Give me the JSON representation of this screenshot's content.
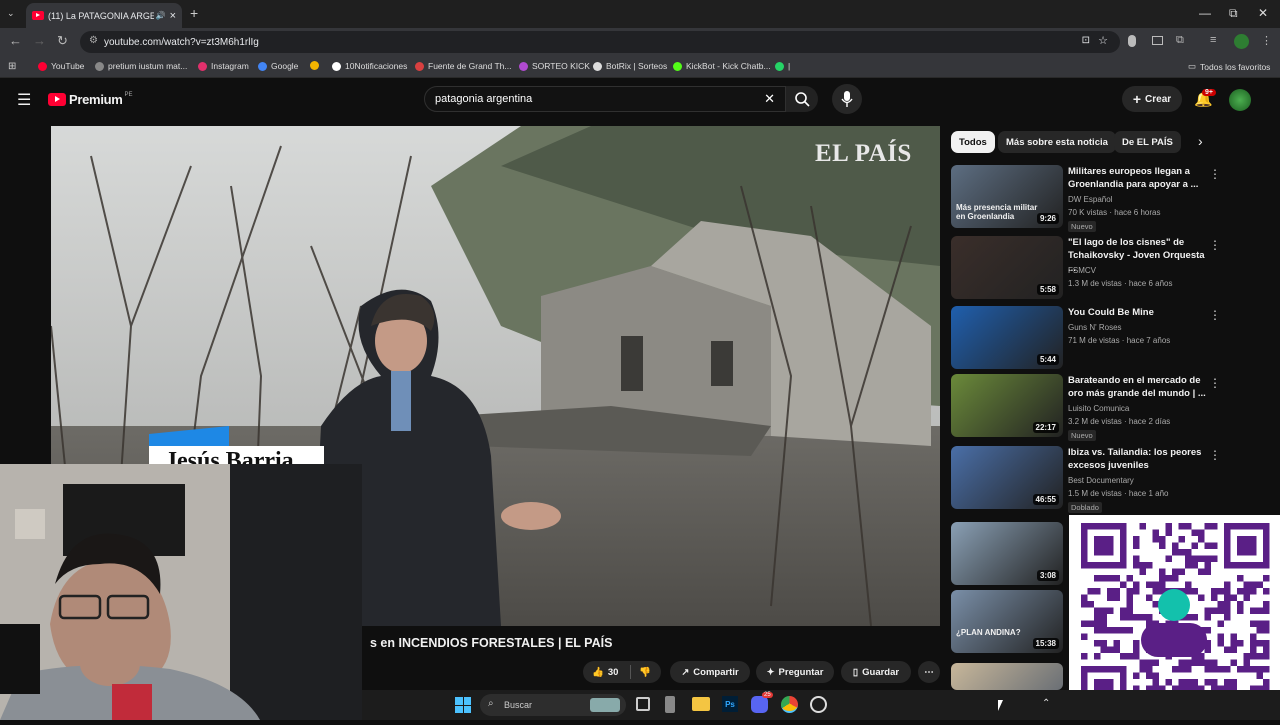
{
  "browser": {
    "tab_title": "(11) La PATAGONIA ARGEN",
    "url": "youtube.com/watch?v=zt3M6h1rlIg",
    "bookmarks": [
      {
        "label": "YouTube",
        "color": "#ff0033"
      },
      {
        "label": "pretium iustum mat...",
        "color": "#888888"
      },
      {
        "label": "Instagram",
        "color": "#e1306c"
      },
      {
        "label": "Google",
        "color": "#4285f4"
      },
      {
        "label": "",
        "color": "#f4b400"
      },
      {
        "label": "10Notificaciones",
        "color": "#ffffff"
      },
      {
        "label": "Fuente de Grand Th...",
        "color": "#d94040"
      },
      {
        "label": "SORTEO KICK",
        "color": "#b04ad0"
      },
      {
        "label": "BotRix | Sorteos",
        "color": "#dddddd"
      },
      {
        "label": "KickBot - Kick Chatb...",
        "color": "#53fc18"
      },
      {
        "label": "|",
        "color": "#25d366"
      }
    ],
    "all_favorites": "Todos los favoritos"
  },
  "youtube": {
    "logo_text": "Premium",
    "logo_region": "PE",
    "search_value": "patagonia argentina",
    "create_label": "Crear",
    "notif_count": "9+",
    "chips": [
      "Todos",
      "Más sobre esta noticia",
      "De EL PAÍS"
    ],
    "video_watermark": "EL PAÍS",
    "lower_third_name": "Jesús Barria",
    "video_title_visible": "s en INCENDIOS FORESTALES | EL PAÍS",
    "likes": "30",
    "share_label": "Compartir",
    "ask_label": "Preguntar",
    "save_label": "Guardar"
  },
  "recommendations": [
    {
      "title": "Militares europeos llegan a Groenlandia para apoyar a ...",
      "channel": "DW Español",
      "meta": "70 K vistas · hace 6 horas",
      "badge": "Nuevo",
      "duration": "9:26",
      "thumb_text": "Más presencia militar en Groenlandia",
      "color": "#5d6e82"
    },
    {
      "title": "\"El lago de los cisnes\" de Tchaikovsky - Joven Orquesta ...",
      "channel": "FSMCV",
      "meta": "1.3 M de vistas · hace 6 años",
      "badge": "",
      "duration": "5:58",
      "thumb_text": "",
      "color": "#3a2e2a"
    },
    {
      "title": "You Could Be Mine",
      "channel": "Guns N' Roses",
      "meta": "71 M de vistas · hace 7 años",
      "badge": "",
      "duration": "5:44",
      "thumb_text": "",
      "color": "#1f5fae"
    },
    {
      "title": "Barateando en el mercado de oro más grande del mundo | ...",
      "channel": "Luisito Comunica",
      "meta": "3.2 M de vistas · hace 2 días",
      "badge": "Nuevo",
      "duration": "22:17",
      "thumb_text": "",
      "color": "#6b8a3a"
    },
    {
      "title": "Ibiza vs. Tailandia: los peores excesos juveniles",
      "channel": "Best Documentary",
      "meta": "1.5 M de vistas · hace 1 año",
      "badge": "Doblado",
      "duration": "46:55",
      "thumb_text": "",
      "color": "#4a6fa8"
    },
    {
      "title": "",
      "channel": "",
      "meta": "",
      "badge": "",
      "duration": "3:08",
      "thumb_text": "",
      "color": "#8aa0b5"
    },
    {
      "title": "",
      "channel": "",
      "meta": "",
      "badge": "",
      "duration": "15:38",
      "thumb_text": "¿PLAN ANDINA?",
      "color": "#7a8fa8"
    }
  ],
  "taskbar": {
    "search_placeholder": "Buscar",
    "discord_badge": "25"
  }
}
